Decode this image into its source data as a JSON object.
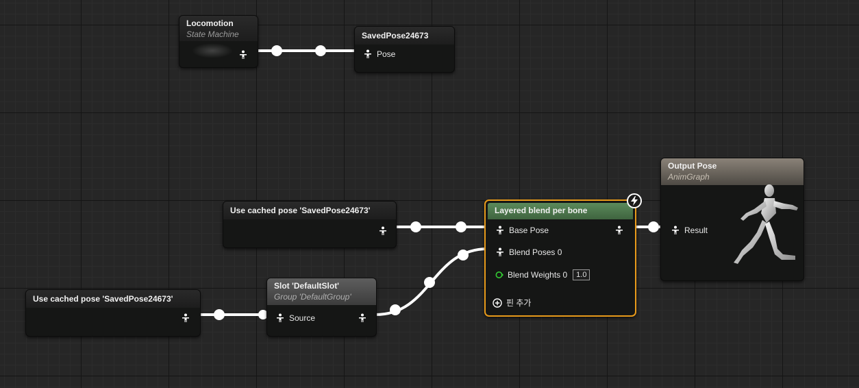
{
  "nodes": {
    "locomotion": {
      "title": "Locomotion",
      "subtitle": "State Machine"
    },
    "saved_pose": {
      "title": "SavedPose24673",
      "pin_label": "Pose"
    },
    "use_cached_1": {
      "title": "Use cached pose 'SavedPose24673'"
    },
    "use_cached_2": {
      "title": "Use cached pose 'SavedPose24673'"
    },
    "slot": {
      "title": "Slot 'DefaultSlot'",
      "subtitle": "Group 'DefaultGroup'",
      "pin_label": "Source"
    },
    "layered_blend": {
      "title": "Layered blend per bone",
      "pins": {
        "base_pose": "Base Pose",
        "blend_poses": "Blend Poses 0",
        "blend_weights": "Blend Weights 0",
        "blend_weight_value": "1.0",
        "add_pin": "핀 추가"
      }
    },
    "output_pose": {
      "title": "Output Pose",
      "subtitle": "AnimGraph",
      "pin_label": "Result"
    }
  },
  "colors": {
    "layered_header": "#4d7a4d",
    "selection_outline": "#e89a1a",
    "wire": "#ffffff",
    "float_pin": "#33cc33"
  },
  "icons": {
    "pose_pin": "pose-person-icon",
    "fast_path": "lightning-icon",
    "add_pin": "plus-circle-icon",
    "preview": "mannequin-running-icon"
  }
}
